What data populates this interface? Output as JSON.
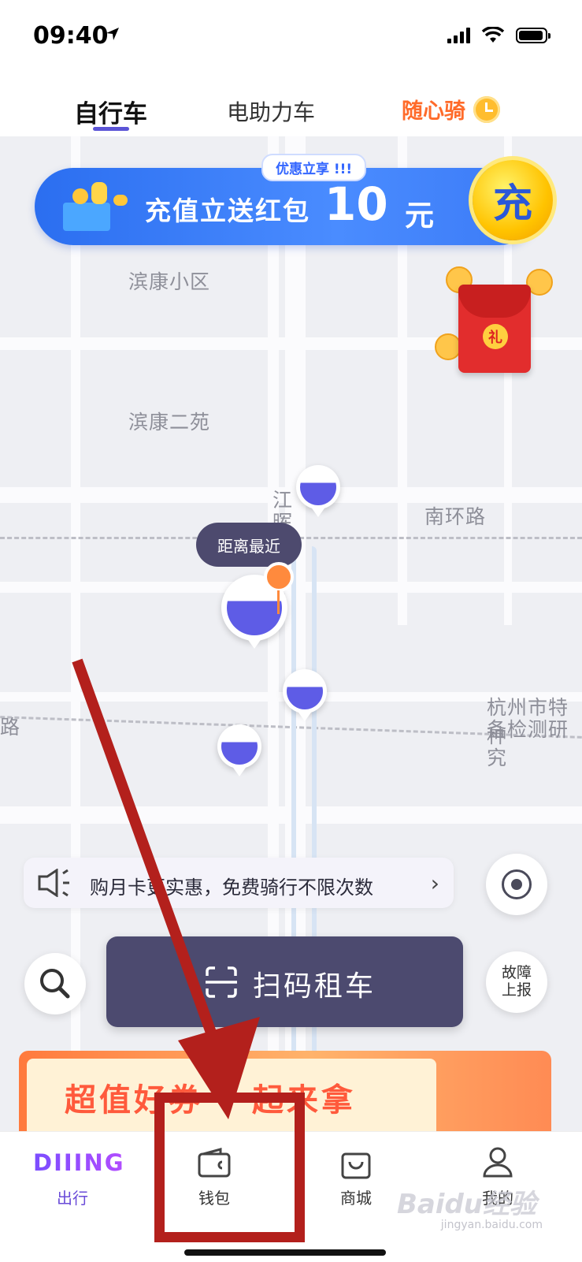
{
  "status_bar": {
    "time": "09:40"
  },
  "tabs": [
    {
      "label": "自行车",
      "active": true
    },
    {
      "label": "电助力车",
      "active": false
    },
    {
      "label": "随心骑",
      "active": false
    }
  ],
  "promo_banner": {
    "tag": "优惠立享 !!!",
    "text": "充值立送红包",
    "amount": "10",
    "unit": "元",
    "badge": "充"
  },
  "red_packet": {
    "label": "礼"
  },
  "map": {
    "labels": [
      "滨康小区",
      "滨康二苑",
      "南环路",
      "江晖",
      "杭州市特种",
      "备检测研究",
      "路"
    ],
    "nearest_label": "距离最近"
  },
  "notice": {
    "text": "购月卡更实惠，免费骑行不限次数"
  },
  "scan_button": {
    "label": "扫码租车"
  },
  "fault_button": {
    "line1": "故障",
    "line2": "上报"
  },
  "bottom_banner": {
    "text": "超值好券 一起来拿"
  },
  "tabbar": {
    "logo": "DIIING",
    "items": [
      {
        "label": "出行",
        "icon": "diiing-logo",
        "active": true
      },
      {
        "label": "钱包",
        "icon": "wallet-icon",
        "active": false
      },
      {
        "label": "商城",
        "icon": "shopping-bag-icon",
        "active": false
      },
      {
        "label": "我的",
        "icon": "person-icon",
        "active": false
      }
    ]
  },
  "watermark": {
    "text": "Baidu经验",
    "sub": "jingyan.baidu.com"
  },
  "colors": {
    "accent": "#5b54d6",
    "scan_button": "#4c4a6f",
    "annotation": "#b3201c",
    "special_tab": "#ff6b2a"
  }
}
